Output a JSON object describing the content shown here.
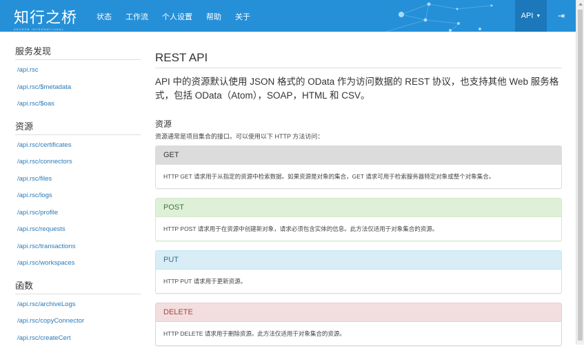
{
  "header": {
    "logo": "知行之桥",
    "logo_sub": "ARCESB INTERNATIONAL",
    "menu": [
      "状态",
      "工作流",
      "个人设置",
      "帮助",
      "关于"
    ],
    "api_label": "API",
    "logout_icon": "sign-out-icon"
  },
  "sidebar": {
    "groups": [
      {
        "title": "服务发现",
        "items": [
          "/api.rsc",
          "/api.rsc/$metadata",
          "/api.rsc/$oas"
        ]
      },
      {
        "title": "资源",
        "items": [
          "/api.rsc/certificates",
          "/api.rsc/connectors",
          "/api.rsc/files",
          "/api.rsc/logs",
          "/api.rsc/profile",
          "/api.rsc/requests",
          "/api.rsc/transactions",
          "/api.rsc/workspaces"
        ]
      },
      {
        "title": "函数",
        "items": [
          "/api.rsc/archiveLogs",
          "/api.rsc/copyConnector",
          "/api.rsc/createCert"
        ]
      }
    ]
  },
  "main": {
    "title": "REST API",
    "lead": "API 中的资源默认使用 JSON 格式的 OData 作为访问数据的 REST 协议，也支持其他 Web 服务格式，包括 OData（Atom），SOAP，HTML 和 CSV。",
    "section_title": "资源",
    "section_sub": "资源通常是项目集合的接口。可以使用以下 HTTP 方法访问：",
    "methods": [
      {
        "name": "GET",
        "desc": "HTTP GET 请求用于从指定的资源中检索数据。如果资源是对象的集合，GET 请求可用于检索服务器特定对象或整个对象集合。"
      },
      {
        "name": "POST",
        "desc": "HTTP POST 请求用于在资源中创建新对象，请求必须包含实体的信息。此方法仅适用于对象集合的资源。"
      },
      {
        "name": "PUT",
        "desc": "HTTP PUT 请求用于更新资源。"
      },
      {
        "name": "DELETE",
        "desc": "HTTP DELETE 请求用于删除资源。此方法仅适用于对象集合的资源。"
      }
    ]
  }
}
